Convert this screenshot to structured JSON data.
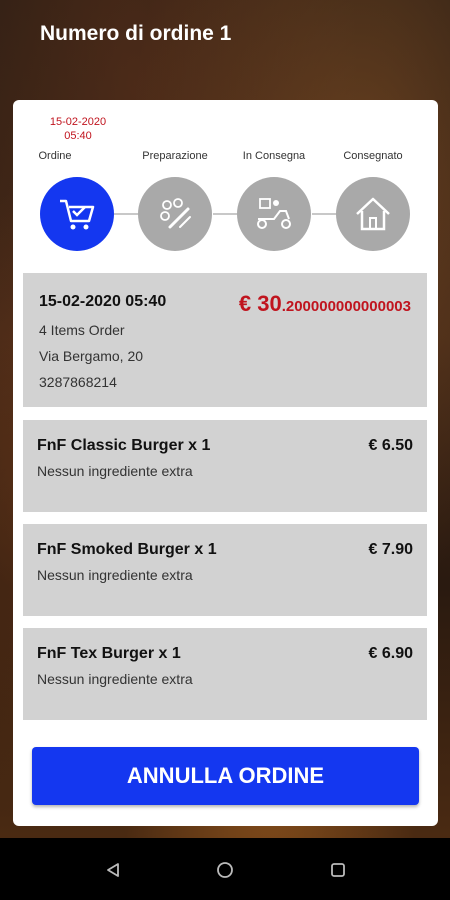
{
  "header": {
    "title": "Numero di ordine 1"
  },
  "tracker": {
    "date": "15-02-2020",
    "time": "05:40",
    "steps": [
      {
        "label": "Ordine",
        "icon": "cart-check-icon",
        "active": true
      },
      {
        "label": "Preparazione",
        "icon": "preparation-icon",
        "active": false
      },
      {
        "label": "In Consegna",
        "icon": "scooter-icon",
        "active": false
      },
      {
        "label": "Consegnato",
        "icon": "home-icon",
        "active": false
      }
    ]
  },
  "summary": {
    "datetime": "15-02-2020 05:40",
    "items_count": "4 Items Order",
    "address": "Via Bergamo, 20",
    "phone": "3287868214",
    "total_main": "€ 30",
    "total_decimals": ".200000000000003"
  },
  "items": [
    {
      "name": "FnF Classic Burger x 1",
      "price": "€ 6.50",
      "extra": "Nessun ingrediente extra"
    },
    {
      "name": "FnF Smoked Burger x 1",
      "price": "€ 7.90",
      "extra": "Nessun ingrediente extra"
    },
    {
      "name": "FnF Tex Burger x 1",
      "price": "€ 6.90",
      "extra": "Nessun ingrediente extra"
    }
  ],
  "actions": {
    "cancel_label": "ANNULLA ORDINE"
  },
  "colors": {
    "accent": "#1437f0",
    "price_red": "#c0141e",
    "inactive_step": "#a9a9a9"
  },
  "navbar": {
    "icons": [
      "back-icon",
      "home-circle-icon",
      "recents-icon"
    ]
  }
}
